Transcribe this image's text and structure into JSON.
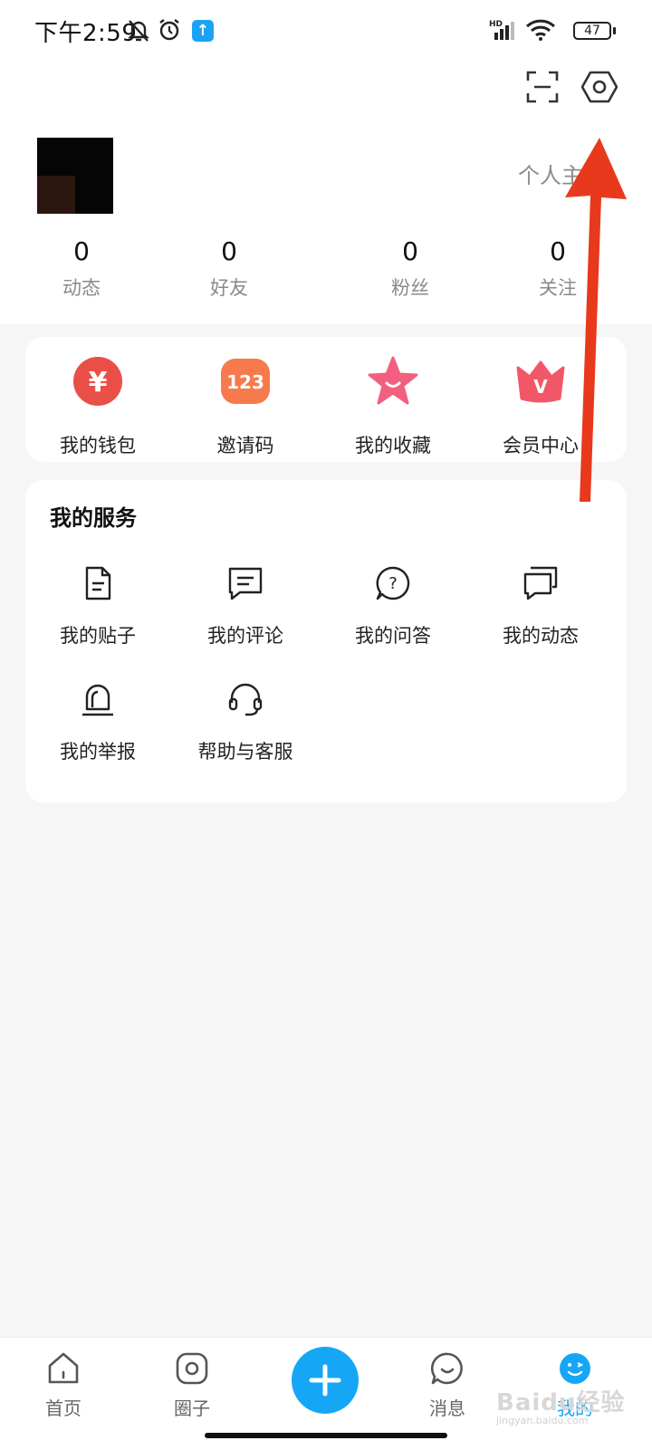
{
  "status_bar": {
    "time": "下午2:59",
    "network_label": "HD",
    "battery": "47"
  },
  "profile": {
    "link_label": "个人主页"
  },
  "stats": [
    {
      "value": "0",
      "label": "动态"
    },
    {
      "value": "0",
      "label": "好友"
    },
    {
      "value": "0",
      "label": "粉丝"
    },
    {
      "value": "0",
      "label": "关注"
    }
  ],
  "quick_actions": [
    {
      "label": "我的钱包",
      "icon": "wallet-icon",
      "glyph": "¥",
      "color": "#ea4f47"
    },
    {
      "label": "邀请码",
      "icon": "invite-code-icon",
      "glyph": "123",
      "color": "#f77a4c"
    },
    {
      "label": "我的收藏",
      "icon": "star-icon",
      "color": "#f2607f"
    },
    {
      "label": "会员中心",
      "icon": "crown-icon",
      "glyph": "V",
      "color": "#f25767"
    }
  ],
  "services": {
    "title": "我的服务",
    "items": [
      {
        "label": "我的贴子",
        "icon": "document-icon"
      },
      {
        "label": "我的评论",
        "icon": "comment-icon"
      },
      {
        "label": "我的问答",
        "icon": "question-bubble-icon"
      },
      {
        "label": "我的动态",
        "icon": "chat-bubbles-icon"
      },
      {
        "label": "我的举报",
        "icon": "alarm-siren-icon"
      },
      {
        "label": "帮助与客服",
        "icon": "headset-icon"
      }
    ]
  },
  "bottom_nav": [
    {
      "label": "首页",
      "icon": "home-icon"
    },
    {
      "label": "圈子",
      "icon": "circle-icon"
    },
    {
      "label": "",
      "icon": "plus-icon"
    },
    {
      "label": "消息",
      "icon": "message-icon"
    },
    {
      "label": "我的",
      "icon": "profile-face-icon",
      "active": true
    }
  ],
  "colors": {
    "accent": "#16a6f6",
    "annotation_arrow": "#e8391c"
  },
  "watermark": {
    "brand": "Baidu经验",
    "url": "jingyan.baidu.com"
  }
}
